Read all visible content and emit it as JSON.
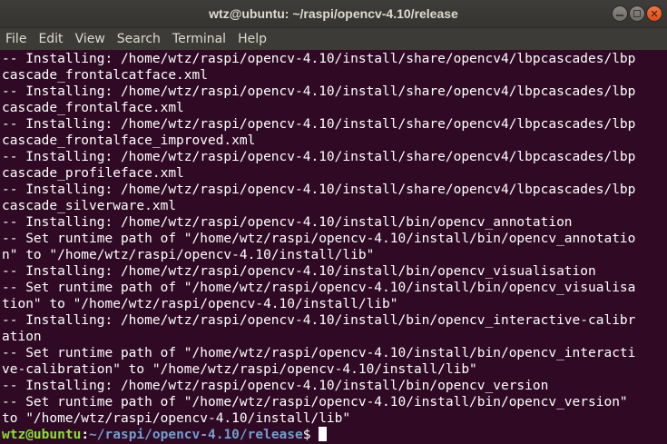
{
  "window": {
    "title": "wtz@ubuntu: ~/raspi/opencv-4.10/release",
    "controls": {
      "minimize_icon": "minimize-icon",
      "maximize_icon": "maximize-icon",
      "close_icon": "close-icon"
    }
  },
  "menubar": {
    "items": [
      "File",
      "Edit",
      "View",
      "Search",
      "Terminal",
      "Help"
    ]
  },
  "terminal": {
    "lines": [
      "-- Installing: /home/wtz/raspi/opencv-4.10/install/share/opencv4/lbpcascades/lbp",
      "cascade_frontalcatface.xml",
      "-- Installing: /home/wtz/raspi/opencv-4.10/install/share/opencv4/lbpcascades/lbp",
      "cascade_frontalface.xml",
      "-- Installing: /home/wtz/raspi/opencv-4.10/install/share/opencv4/lbpcascades/lbp",
      "cascade_frontalface_improved.xml",
      "-- Installing: /home/wtz/raspi/opencv-4.10/install/share/opencv4/lbpcascades/lbp",
      "cascade_profileface.xml",
      "-- Installing: /home/wtz/raspi/opencv-4.10/install/share/opencv4/lbpcascades/lbp",
      "cascade_silverware.xml",
      "-- Installing: /home/wtz/raspi/opencv-4.10/install/bin/opencv_annotation",
      "-- Set runtime path of \"/home/wtz/raspi/opencv-4.10/install/bin/opencv_annotatio",
      "n\" to \"/home/wtz/raspi/opencv-4.10/install/lib\"",
      "-- Installing: /home/wtz/raspi/opencv-4.10/install/bin/opencv_visualisation",
      "-- Set runtime path of \"/home/wtz/raspi/opencv-4.10/install/bin/opencv_visualisa",
      "tion\" to \"/home/wtz/raspi/opencv-4.10/install/lib\"",
      "-- Installing: /home/wtz/raspi/opencv-4.10/install/bin/opencv_interactive-calibr",
      "ation",
      "-- Set runtime path of \"/home/wtz/raspi/opencv-4.10/install/bin/opencv_interacti",
      "ve-calibration\" to \"/home/wtz/raspi/opencv-4.10/install/lib\"",
      "-- Installing: /home/wtz/raspi/opencv-4.10/install/bin/opencv_version",
      "-- Set runtime path of \"/home/wtz/raspi/opencv-4.10/install/bin/opencv_version\"",
      "to \"/home/wtz/raspi/opencv-4.10/install/lib\""
    ],
    "prompt": {
      "user_host": "wtz@ubuntu",
      "separator": ":",
      "path": "~/raspi/opencv-4.10/release",
      "symbol": "$ "
    }
  },
  "colors": {
    "terminal_bg": "#300a24",
    "terminal_fg": "#ffffff",
    "prompt_user": "#8ae234",
    "prompt_path": "#729fcf",
    "titlebar_bg": "#3a3935",
    "menubar_bg": "#3c3b37",
    "close_button": "#e95420"
  }
}
